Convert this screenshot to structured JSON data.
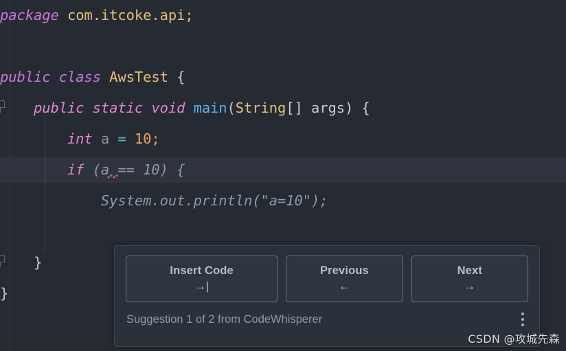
{
  "editor": {
    "theme_bg": "#262b33",
    "current_line_bg": "#2e333d",
    "lines": [
      {
        "id": "package-line",
        "tokens": [
          {
            "t": "package",
            "c": "kw"
          },
          {
            "t": " ",
            "c": "plain"
          },
          {
            "t": "com.itcoke.api;",
            "c": "type"
          }
        ]
      },
      {
        "id": "class-line",
        "tokens": [
          {
            "t": "public class ",
            "c": "kw"
          },
          {
            "t": "AwsTest",
            "c": "type"
          },
          {
            "t": " {",
            "c": "plain"
          }
        ]
      },
      {
        "id": "main-signature-line",
        "tokens": [
          {
            "t": "    public static void ",
            "c": "kw2"
          },
          {
            "t": "main",
            "c": "fn"
          },
          {
            "t": "(",
            "c": "plain"
          },
          {
            "t": "String",
            "c": "type"
          },
          {
            "t": "[] args) {",
            "c": "plain"
          }
        ]
      },
      {
        "id": "int-declaration-line",
        "tokens": [
          {
            "t": "        int",
            "c": "kw2"
          },
          {
            "t": " a ",
            "c": "var"
          },
          {
            "t": "=",
            "c": "op"
          },
          {
            "t": " ",
            "c": "plain"
          },
          {
            "t": "10",
            "c": "num"
          },
          {
            "t": ";",
            "c": "num"
          }
        ]
      },
      {
        "id": "if-statement-line",
        "tokens": [
          {
            "t": "        if",
            "c": "kw2"
          },
          {
            "t": " (a == 10) {",
            "c": "ghost-b"
          }
        ]
      },
      {
        "id": "println-ghost-line",
        "tokens": [
          {
            "t": "            System.out.println(\"a=10\");",
            "c": "ghost-b"
          }
        ]
      },
      {
        "id": "inner-close-brace-line",
        "tokens": [
          {
            "t": "    }",
            "c": "plain"
          }
        ]
      },
      {
        "id": "outer-close-brace-line",
        "tokens": [
          {
            "t": "}",
            "c": "plain"
          }
        ]
      }
    ]
  },
  "popup": {
    "buttons": [
      {
        "label": "Insert Code",
        "key_glyph": "→|",
        "icon_name": "tab-key-icon"
      },
      {
        "label": "Previous",
        "key_glyph": "←",
        "icon_name": "arrow-left-key-icon"
      },
      {
        "label": "Next",
        "key_glyph": "→",
        "icon_name": "arrow-right-key-icon"
      }
    ],
    "status_text": "Suggestion 1 of 2 from CodeWhisperer",
    "more_icon": "more-vertical-icon"
  },
  "watermark": {
    "text": "CSDN @攻城先森"
  }
}
